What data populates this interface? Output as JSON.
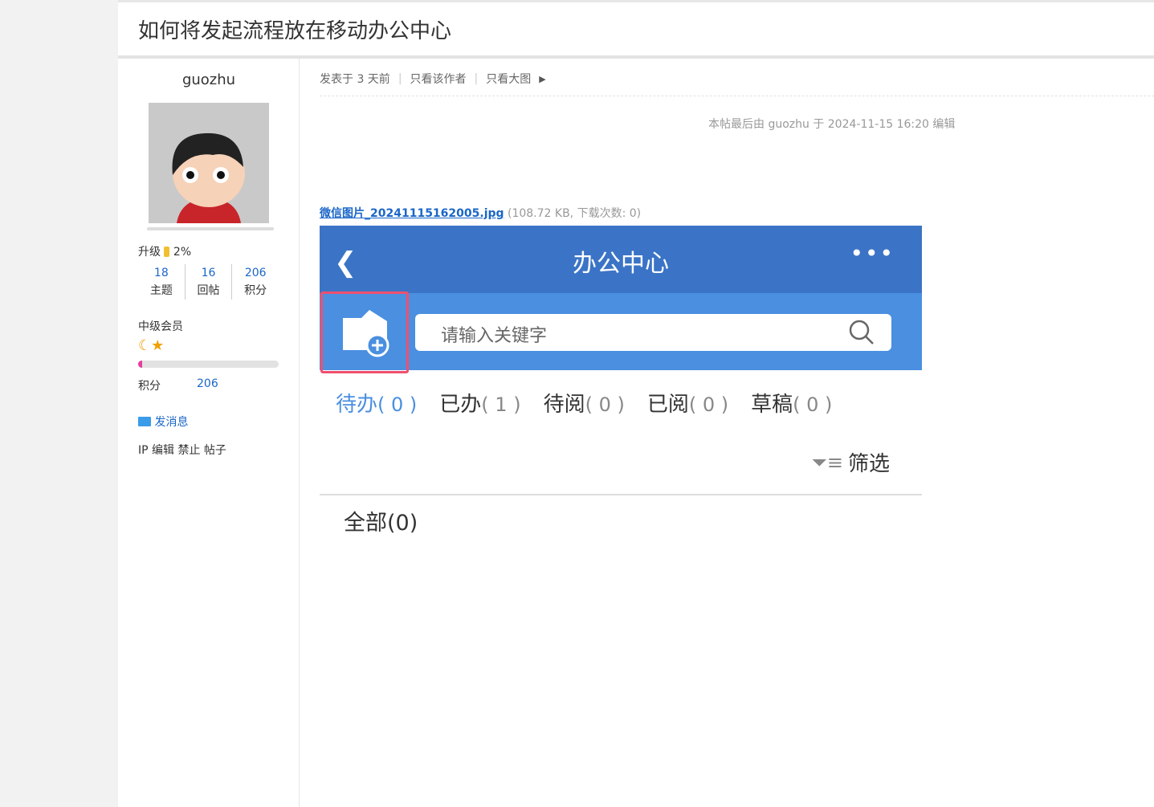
{
  "thread": {
    "title": "如何将发起流程放在移动办公中心"
  },
  "user": {
    "name": "guozhu",
    "upgrade_label": "升级",
    "upgrade_pct": "2%",
    "stats": [
      {
        "value": "18",
        "label": "主题"
      },
      {
        "value": "16",
        "label": "回帖"
      },
      {
        "value": "206",
        "label": "积分"
      }
    ],
    "group": "中级会员",
    "points_label": "积分",
    "points": "206",
    "points_progress": 0.02,
    "message": "发消息",
    "actions": "IP 编辑 禁止 帖子"
  },
  "post": {
    "posted": "发表于 3 天前",
    "only_author": "只看该作者",
    "only_big": "只看大图",
    "edited": "本帖最后由 guozhu 于 2024-11-15 16:20 编辑",
    "attachment_name": "微信图片_20241115162005.jpg",
    "attachment_info": "(108.72 KB, 下载次数: 0)"
  },
  "phone": {
    "title": "办公中心",
    "search_placeholder": "请输入关键字",
    "tabs": [
      {
        "label": "待办",
        "count": "( 0 )"
      },
      {
        "label": "已办",
        "count": "( 1 )"
      },
      {
        "label": "待阅",
        "count": "( 0 )"
      },
      {
        "label": "已阅",
        "count": "( 0 )"
      },
      {
        "label": "草稿",
        "count": "( 0 )"
      }
    ],
    "filter": "筛选",
    "all": "全部(0)"
  }
}
